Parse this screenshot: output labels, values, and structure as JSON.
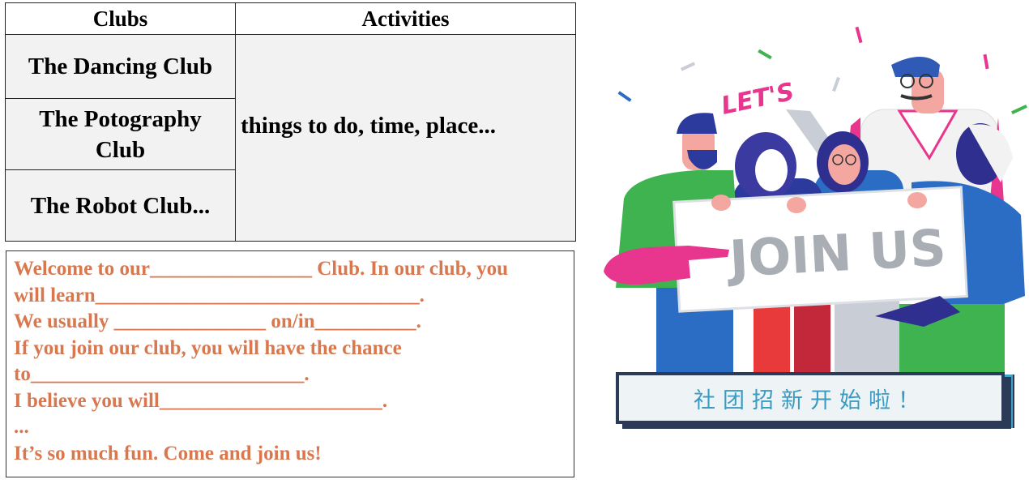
{
  "table": {
    "headers": [
      "Clubs",
      "Activities"
    ],
    "clubs": [
      "The Dancing Club",
      "The Potography Club",
      "The Robot Club..."
    ],
    "activities": "things to do, time, place..."
  },
  "template": {
    "lines": [
      "Welcome to our________________ Club. In our club, you",
      "will learn________________________________.",
      "We usually _______________ on/in__________.",
      "If you join our club, you will have the chance",
      "to___________________________.",
      "I believe you will______________________.",
      "...",
      "It’s so much fun. Come and join us!"
    ]
  },
  "illustration": {
    "lets_text": "LET'S",
    "sign_text": "JOIN US",
    "banner_text": "社团招新开始啦！"
  },
  "colors": {
    "template_text": "#d9784f",
    "table_fill": "#f2f2f2",
    "banner_text": "#3a9bc2",
    "banner_border": "#2b3a56"
  }
}
